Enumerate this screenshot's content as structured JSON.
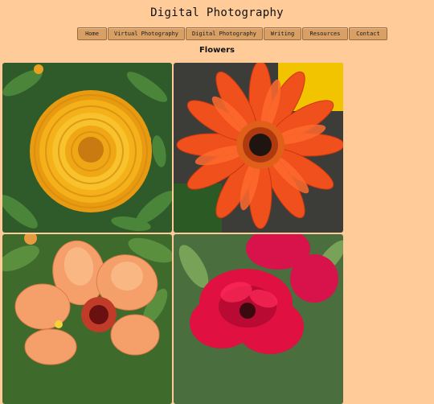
{
  "site": {
    "title": "Digital Photography"
  },
  "nav": {
    "items": [
      {
        "label": "Home"
      },
      {
        "label": "Virtual Photography"
      },
      {
        "label": "Digital Photography"
      },
      {
        "label": "Writing"
      },
      {
        "label": "Resources"
      },
      {
        "label": "Contact"
      }
    ]
  },
  "page": {
    "heading": "Flowers"
  },
  "gallery": {
    "photos": [
      {
        "subject": "orange-marigold"
      },
      {
        "subject": "orange-gerbera-daisy"
      },
      {
        "subject": "peach-hibiscus"
      },
      {
        "subject": "pink-red-rose"
      }
    ]
  },
  "colors": {
    "background": "#ffcc99",
    "nav_button": "#d9a066",
    "nav_border": "#9b6a3e"
  }
}
